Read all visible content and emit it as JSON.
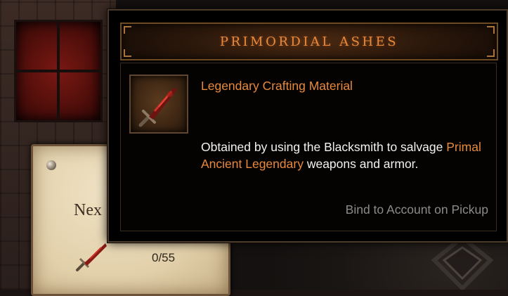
{
  "tooltip": {
    "title": "PRIMORDIAL ASHES",
    "item_type": "Legendary Crafting Material",
    "description": {
      "part1": "Obtained by using the Blacksmith to salvage",
      "highlight": "Primal Ancient Legendary",
      "part2": "weapons and armor."
    },
    "bind_text": "Bind to Account on Pickup",
    "item_icon": "sword-icon"
  },
  "background": {
    "panel_label": "Nex",
    "progress": "0/55",
    "progress_icon": "sword-icon"
  },
  "colors": {
    "legendary_orange": "#e8893c",
    "body_text": "#f2f2f2",
    "muted_text": "#8b8b8b",
    "tooltip_bg": "#000000"
  }
}
